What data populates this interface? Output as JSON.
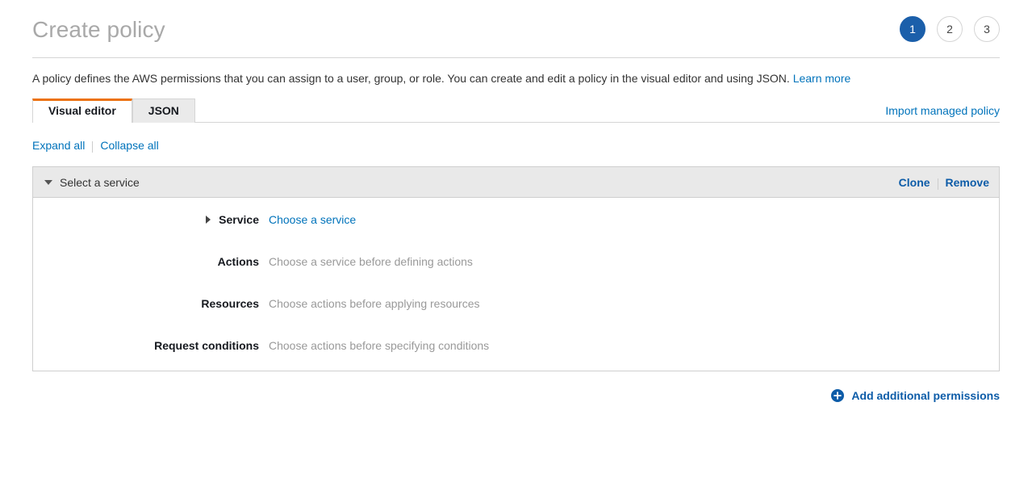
{
  "header": {
    "title": "Create policy",
    "steps": [
      {
        "label": "1",
        "active": true
      },
      {
        "label": "2",
        "active": false
      },
      {
        "label": "3",
        "active": false
      }
    ]
  },
  "description": {
    "text": "A policy defines the AWS permissions that you can assign to a user, group, or role. You can create and edit a policy in the visual editor and using JSON.",
    "learn_more": "Learn more"
  },
  "tabs": [
    {
      "label": "Visual editor",
      "active": true
    },
    {
      "label": "JSON",
      "active": false
    }
  ],
  "tabbar": {
    "import_managed_policy": "Import managed policy"
  },
  "toolbar": {
    "expand_all": "Expand all",
    "collapse_all": "Collapse all"
  },
  "card": {
    "header": {
      "title": "Select a service",
      "toggle_icon": "chevron-down-icon",
      "clone": "Clone",
      "remove": "Remove"
    },
    "rows": [
      {
        "label": "Service",
        "value": "Choose a service",
        "is_link": true,
        "has_toggle": true
      },
      {
        "label": "Actions",
        "value": "Choose a service before defining actions",
        "is_link": false,
        "has_toggle": false
      },
      {
        "label": "Resources",
        "value": "Choose actions before applying resources",
        "is_link": false,
        "has_toggle": false
      },
      {
        "label": "Request conditions",
        "value": "Choose actions before specifying conditions",
        "is_link": false,
        "has_toggle": false
      }
    ]
  },
  "footer": {
    "add_permissions": "Add additional permissions",
    "add_icon": "plus-circle-icon"
  },
  "colors": {
    "accent_orange": "#ec7211",
    "link_blue": "#0073bb",
    "active_step_blue": "#1b5faa",
    "title_gray": "#a9a9a9",
    "muted_gray": "#999999",
    "card_header_gray": "#e9e9e9"
  }
}
